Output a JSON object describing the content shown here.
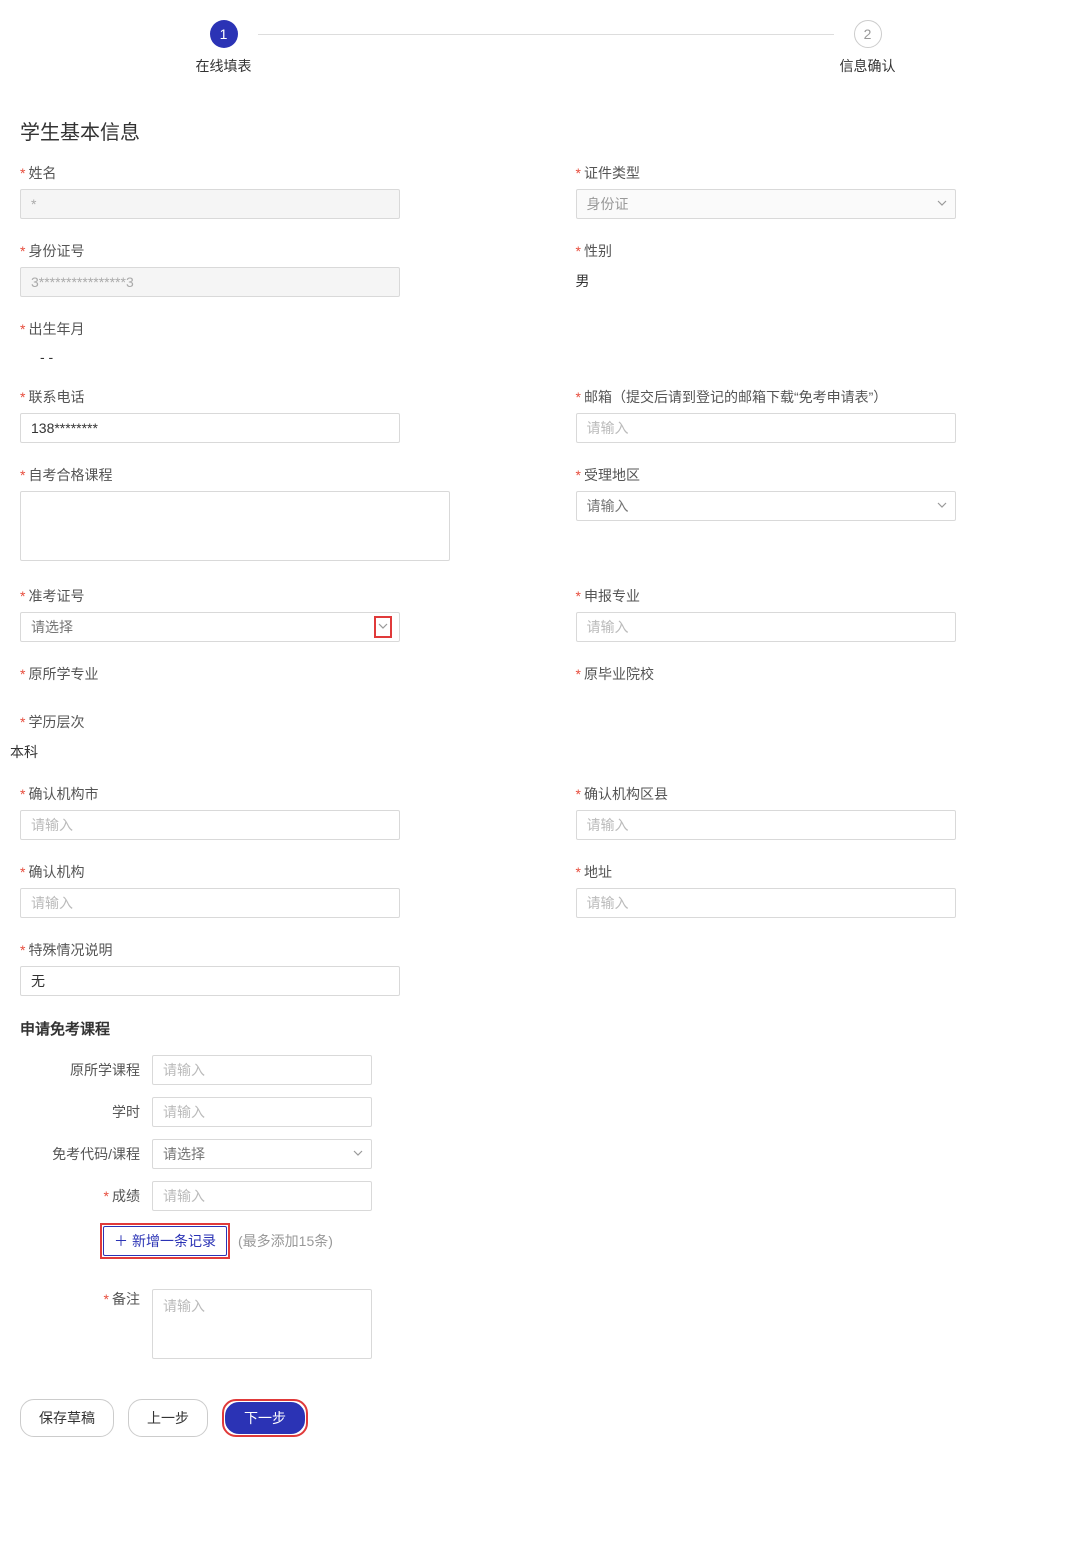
{
  "steps": {
    "s1": "1",
    "s1_label": "在线填表",
    "s2": "2",
    "s2_label": "信息确认"
  },
  "section": {
    "basic": "学生基本信息"
  },
  "labels": {
    "name": "姓名",
    "id_type": "证件类型",
    "id_no": "身份证号",
    "gender": "性别",
    "birth": "出生年月",
    "phone": "联系电话",
    "email": "邮箱（提交后请到登记的邮箱下载“免考申请表”）",
    "pass_course": "自考合格课程",
    "region": "受理地区",
    "exam_no": "准考证号",
    "declare_major": "申报专业",
    "orig_major": "原所学专业",
    "orig_school": "原毕业院校",
    "level": "学历层次",
    "confirm_city": "确认机构市",
    "confirm_county": "确认机构区县",
    "confirm_org": "确认机构",
    "address": "地址",
    "special": "特殊情况说明"
  },
  "values": {
    "name": "*",
    "id_type": "身份证",
    "id_no": "3****************3",
    "gender": "男",
    "birth": "    -   -",
    "phone": "138********",
    "level": "本科",
    "special": "无"
  },
  "placeholders": {
    "input": "请输入",
    "select": "请选择"
  },
  "apply": {
    "title": "申请免考课程",
    "orig_course": "原所学课程",
    "hours": "学时",
    "exempt_code": "免考代码/课程",
    "score": "成绩",
    "remark": "备注",
    "add_btn": "新增一条记录",
    "add_hint": "(最多添加15条)"
  },
  "actions": {
    "save_draft": "保存草稿",
    "prev": "上一步",
    "next": "下一步"
  }
}
